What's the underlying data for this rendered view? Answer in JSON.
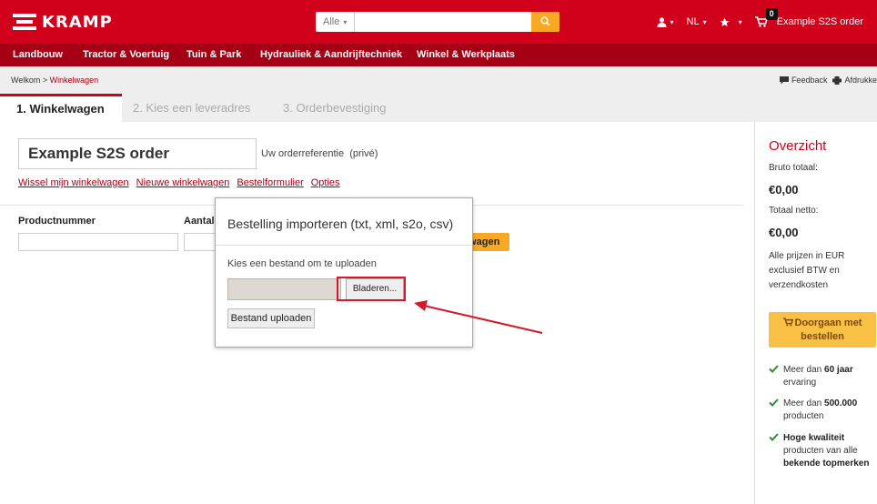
{
  "header": {
    "brand": "KRAMP",
    "search": {
      "category": "Alle",
      "placeholder": ""
    },
    "language": "NL",
    "cart": {
      "count": "0",
      "label": "Example S2S order"
    }
  },
  "nav": {
    "items": [
      "Landbouw",
      "Tractor & Voertuig",
      "Tuin & Park",
      "Hydrauliek & Aandrijftechniek",
      "Winkel & Werkplaats"
    ]
  },
  "breadcrumb": {
    "home": "Welkom",
    "separator": " > ",
    "current": "Winkelwagen"
  },
  "tools": {
    "feedback": "Feedback",
    "print": "Afdrukke"
  },
  "steps": [
    "1.  Winkelwagen",
    "2.  Kies een leveradres",
    "3.  Orderbevestiging"
  ],
  "order": {
    "name": "Example S2S order",
    "reference_label": "Uw orderreferentie",
    "reference_note": "(privé)"
  },
  "links": [
    "Wissel mijn winkelwagen",
    "Nieuwe winkelwagen",
    "Bestelformulier",
    "Opties"
  ],
  "form": {
    "product_label": "Productnummer",
    "amount_label": "Aantal",
    "add_button": "lwagen"
  },
  "popup": {
    "title": "Bestelling importeren (txt, xml, s2o, csv)",
    "hint": "Kies een bestand om te uploaden",
    "browse": "Bladeren...",
    "upload": "Bestand uploaden"
  },
  "summary": {
    "title": "Overzicht",
    "gross_label": "Bruto totaal:",
    "gross_value": "€0,00",
    "net_label": "Totaal netto:",
    "net_value": "€0,00",
    "note": "Alle prijzen in EUR exclusief BTW en verzendkosten",
    "continue_line1": "Doorgaan met",
    "continue_line2": "bestellen",
    "usp1_a": "Meer dan ",
    "usp1_b": "60 jaar",
    "usp1_c": " ervaring",
    "usp2_a": "Meer dan ",
    "usp2_b": "500.000",
    "usp2_c": " producten",
    "usp3_a": "Hoge kwaliteit",
    "usp3_b": " producten van alle ",
    "usp3_c": "bekende topmerken"
  },
  "colors": {
    "brand_red": "#d1001b",
    "nav_red": "#a50015",
    "accent_orange": "#f9a823",
    "check_green": "#2e8b2e",
    "annotation_red": "#d21a2a"
  },
  "icons": [
    "kramp-logo-icon",
    "search-icon",
    "user-icon",
    "star-icon",
    "cart-icon",
    "feedback-icon",
    "print-icon",
    "check-icon"
  ]
}
